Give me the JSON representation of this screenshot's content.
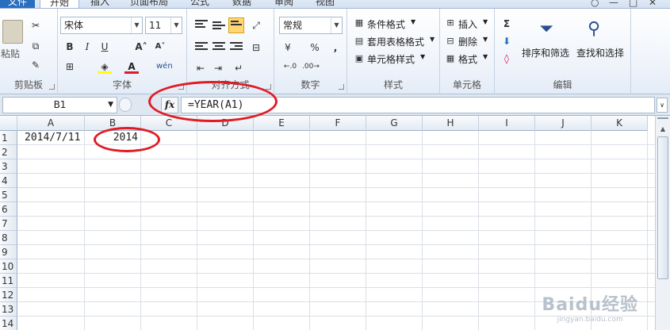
{
  "tabs": [
    "文件",
    "开始",
    "插入",
    "页面布局",
    "公式",
    "数据",
    "审阅",
    "视图"
  ],
  "ribbon": {
    "clipboard": {
      "paste": "粘贴",
      "label": "剪贴板"
    },
    "font": {
      "name": "宋体",
      "size": "11",
      "label": "字体"
    },
    "alignment": {
      "label": "对齐方式"
    },
    "number": {
      "format": "常规",
      "label": "数字"
    },
    "styles": {
      "conditional": "条件格式",
      "table": "套用表格格式",
      "cell": "单元格样式",
      "label": "样式"
    },
    "cells": {
      "insert": "插入",
      "delete": "删除",
      "format": "格式",
      "label": "单元格"
    },
    "editing": {
      "sort": "排序和筛选",
      "find": "查找和选择",
      "label": "编辑"
    }
  },
  "formula_bar": {
    "name_box": "B1",
    "fx": "fx",
    "formula": "=YEAR(A1)"
  },
  "sheet": {
    "columns": [
      "A",
      "B",
      "C",
      "D",
      "E",
      "F",
      "G",
      "H",
      "I",
      "J",
      "K"
    ],
    "rows": [
      "1",
      "2",
      "3",
      "4",
      "5",
      "6",
      "7",
      "8",
      "9",
      "10",
      "11",
      "12",
      "13",
      "14"
    ],
    "a1": "2014/7/11",
    "b1": "2014"
  },
  "watermark": {
    "brand": "Baidu经验",
    "url": "jingyan.baidu.com"
  },
  "colors": {
    "annotation": "#e01b24",
    "file_tab": "#2a6fbf"
  }
}
